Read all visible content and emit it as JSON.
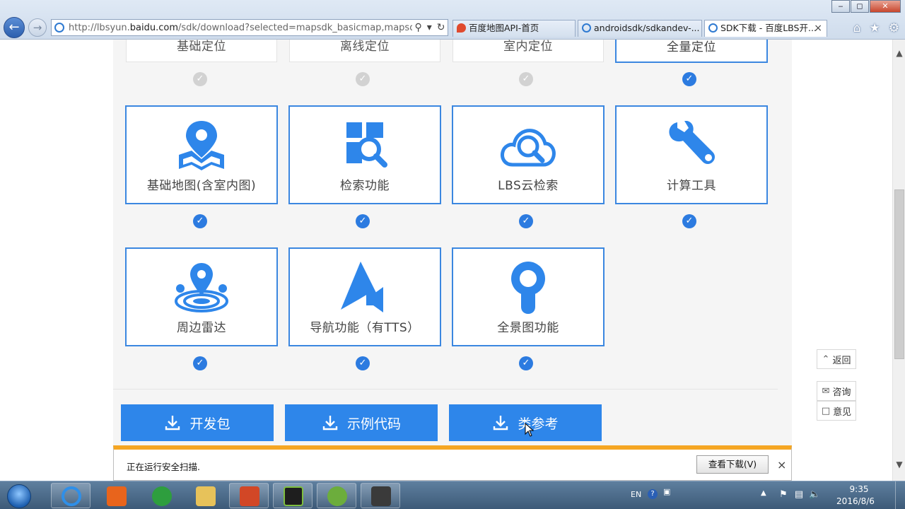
{
  "browser": {
    "url_prefix": "http://lbsyun.",
    "url_domain": "baidu.com",
    "url_suffix": "/sdk/download?selected=mapsdk_basicmap,mapsdk_searc",
    "tabs": [
      {
        "label": "百度地图API-首页",
        "icon_color": "#e04a2e"
      },
      {
        "label": "androidsdk/sdkandev-...",
        "icon_color": "#2f7ad1"
      },
      {
        "label": "SDK下载 - 百度LBS开...",
        "icon_color": "#2f7ad1"
      }
    ],
    "window_buttons": {
      "minimize": "‒",
      "maximize": "◻",
      "close": "✕"
    }
  },
  "page": {
    "partial_cards": [
      {
        "label": "基础定位",
        "checked": false
      },
      {
        "label": "离线定位",
        "checked": false
      },
      {
        "label": "室内定位",
        "checked": false
      },
      {
        "label": "全量定位",
        "checked": true
      }
    ],
    "cards": [
      {
        "label": "基础地图(含室内图)",
        "icon": "map-pin-icon",
        "checked": true
      },
      {
        "label": "检索功能",
        "icon": "search-grid-icon",
        "checked": true
      },
      {
        "label": "LBS云检索",
        "icon": "cloud-search-icon",
        "checked": true
      },
      {
        "label": "计算工具",
        "icon": "wrench-icon",
        "checked": true
      },
      {
        "label": "周边雷达",
        "icon": "radar-icon",
        "checked": true
      },
      {
        "label": "导航功能（有TTS）",
        "icon": "navigation-icon",
        "checked": true
      },
      {
        "label": "全景图功能",
        "icon": "panorama-icon",
        "checked": true
      }
    ],
    "download_buttons": [
      {
        "label": "开发包"
      },
      {
        "label": "示例代码"
      },
      {
        "label": "类参考"
      }
    ],
    "side": {
      "back": "返回",
      "consult": "咨询",
      "feedback": "意见"
    },
    "accent_color": "#2e86ea"
  },
  "notification": {
    "text": "正在运行安全扫描.",
    "view_downloads": "查看下载(V)",
    "close": "×"
  },
  "taskbar": {
    "lang": "EN",
    "time": "9:35",
    "date": "2016/8/6"
  }
}
